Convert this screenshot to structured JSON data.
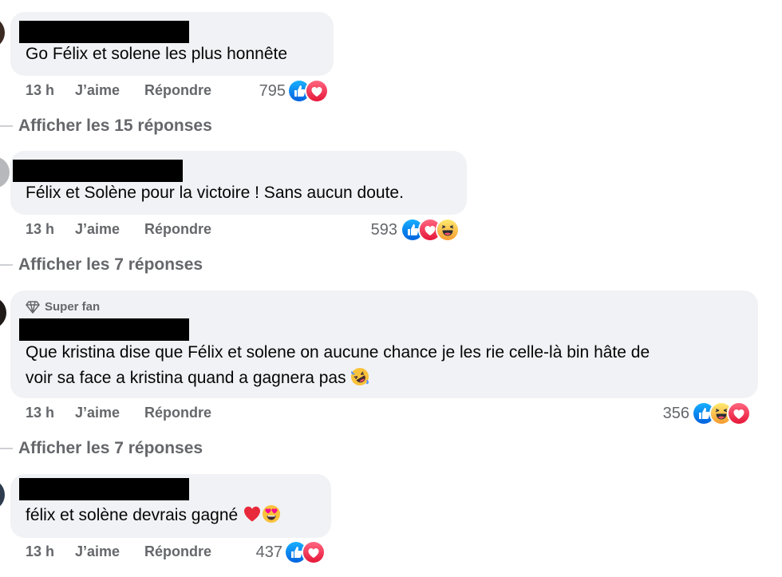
{
  "comments": [
    {
      "text": "Go Félix et solene les plus honnête",
      "time": "13 h",
      "like": "J’aime",
      "reply": "Répondre",
      "reaction_count": "795",
      "reactions": [
        "like-icon",
        "love-icon"
      ],
      "replies_link": "Afficher les 15 réponses"
    },
    {
      "text": "Félix et Solène pour la victoire ! Sans aucun doute.",
      "time": "13 h",
      "like": "J’aime",
      "reply": "Répondre",
      "reaction_count": "593",
      "reactions": [
        "like-icon",
        "love-icon",
        "haha-icon"
      ],
      "replies_link": "Afficher les 7 réponses"
    },
    {
      "badge": "Super fan",
      "text_line1": "Que kristina dise que Félix et solene on aucune chance je les rie celle-là bin hâte de",
      "text_line2": "voir sa face a kristina quand a gagnera pas",
      "inline_emoji": "rolling-on-floor-laughing-emoji",
      "time": "13 h",
      "like": "J’aime",
      "reply": "Répondre",
      "reaction_count": "356",
      "reactions": [
        "like-icon",
        "haha-icon",
        "love-icon"
      ],
      "replies_link": "Afficher les 7 réponses"
    },
    {
      "text": "félix et solène devrais gagné",
      "inline_emojis": [
        "red-heart-emoji",
        "heart-eyes-emoji"
      ],
      "time": "13 h",
      "like": "J’aime",
      "reply": "Répondre",
      "reaction_count": "437",
      "reactions": [
        "like-icon",
        "love-icon"
      ]
    }
  ],
  "colors": {
    "bubble": "#f0f2f5",
    "meta_text": "#65676b",
    "like_blue": "#1877f2",
    "love_red": "#f33e58",
    "haha_yellow": "#f7b125"
  }
}
